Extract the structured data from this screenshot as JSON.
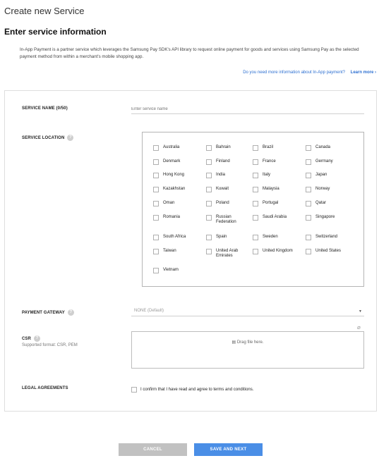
{
  "page_title": "Create new Service",
  "section_title": "Enter service information",
  "intro": "In-App Payment is a partner service which leverages the Samsung Pay SDK's API library to request online payment for goods and services using Samsung Pay as the selected payment method from within a merchant's mobile shopping app.",
  "more_info": {
    "question": "Do you need more information about In-App payment?",
    "link": "Learn more ›"
  },
  "form": {
    "service_name_label": "SERVICE NAME (0/50)",
    "service_name_placeholder": "Enter service name",
    "service_location_label": "SERVICE LOCATION",
    "countries": [
      "Australia",
      "Bahrain",
      "Brazil",
      "Canada",
      "Denmark",
      "Finland",
      "France",
      "Germany",
      "Hong Kong",
      "India",
      "Italy",
      "Japan",
      "Kazakhstan",
      "Kuwait",
      "Malaysia",
      "Norway",
      "Oman",
      "Poland",
      "Portugal",
      "Qatar",
      "Romania",
      "Russian Federation",
      "Saudi Arabia",
      "Singapore",
      "South Africa",
      "Spain",
      "Sweden",
      "Switzerland",
      "Taiwan",
      "United Arab Emirates",
      "United Kingdom",
      "United States",
      "Vietnam"
    ],
    "payment_gateway_label": "PAYMENT GATEWAY",
    "payment_gateway_value": "NONE (Default)",
    "csr_label": "CSR",
    "csr_subtitle": "Supported format: CSR, PEM",
    "drop_text": "Drag file here.",
    "legal_label": "LEGAL AGREEMENTS",
    "legal_text": "I confirm that I have read and agree to terms and conditions."
  },
  "buttons": {
    "cancel": "CANCEL",
    "save": "SAVE AND NEXT"
  },
  "colors": {
    "primary": "#4a8ee6",
    "cancel": "#c1c1c1",
    "link": "#2c6fd1"
  }
}
